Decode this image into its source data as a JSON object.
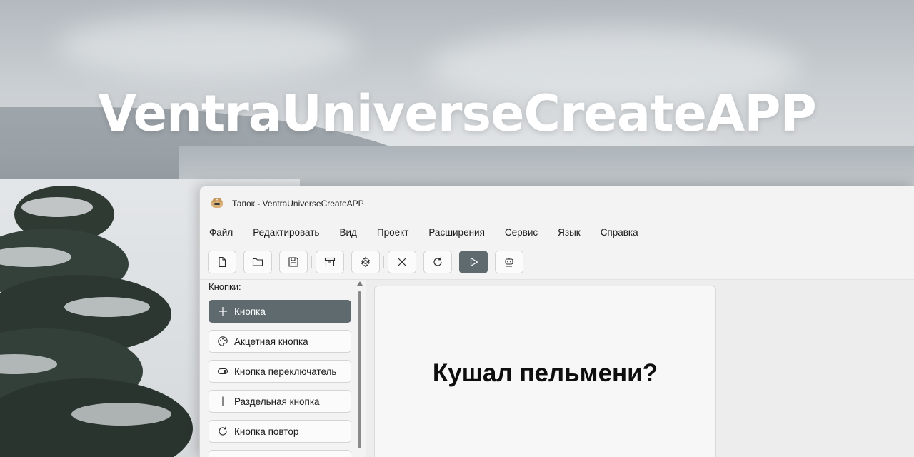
{
  "banner": {
    "title": "VentraUniverseCreateAPP"
  },
  "window": {
    "title": "Тапок - VentraUniverseCreateAPP"
  },
  "menu": [
    "Файл",
    "Редактировать",
    "Вид",
    "Проект",
    "Расширения",
    "Сервис",
    "Язык",
    "Справка"
  ],
  "toolbar": {
    "buttons": [
      {
        "icon": "new-file-icon"
      },
      {
        "icon": "open-folder-icon"
      },
      {
        "icon": "save-icon"
      },
      {
        "icon": "archive-icon"
      },
      {
        "icon": "settings-icon"
      },
      {
        "icon": "close-icon"
      },
      {
        "icon": "refresh-icon"
      },
      {
        "icon": "play-icon",
        "active": true
      },
      {
        "icon": "robot-icon"
      }
    ]
  },
  "sidebar": {
    "heading": "Кнопки:",
    "items": [
      {
        "label": "Кнопка",
        "icon": "plus-icon",
        "selected": true
      },
      {
        "label": "Акцетная кнопка",
        "icon": "palette-icon"
      },
      {
        "label": "Кнопка переключатель",
        "icon": "toggle-icon"
      },
      {
        "label": "Раздельная кнопка",
        "icon": "split-icon"
      },
      {
        "label": "Кнопка повтор",
        "icon": "repeat-icon"
      }
    ]
  },
  "canvas": {
    "text": "Кушал пельмени?"
  },
  "colors": {
    "accent": "#5f6a6f",
    "window_bg": "#f3f3f3"
  }
}
